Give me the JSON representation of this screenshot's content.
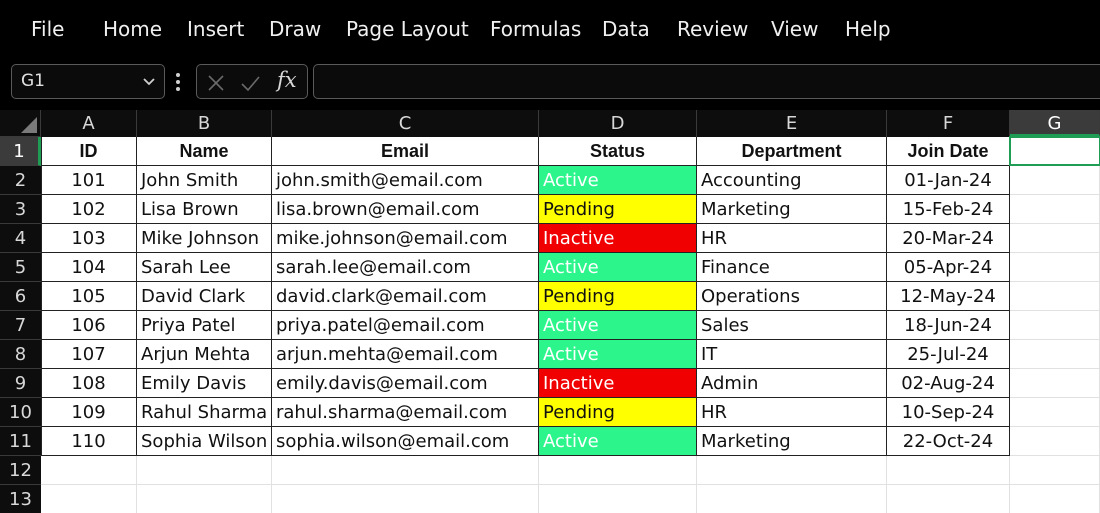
{
  "menu": [
    "File",
    "Home",
    "Insert",
    "Draw",
    "Page Layout",
    "Formulas",
    "Data",
    "Review",
    "View",
    "Help"
  ],
  "formula_bar": {
    "name_box": "G1",
    "fx_label": "fx",
    "formula": "",
    "icons": [
      "chevron-down-icon",
      "more-options-icon",
      "cancel-x-icon",
      "enter-check-icon"
    ]
  },
  "columns": [
    "A",
    "B",
    "C",
    "D",
    "E",
    "F",
    "G"
  ],
  "selected_column": "G",
  "selected_row": "1",
  "row_numbers": [
    "1",
    "2",
    "3",
    "4",
    "5",
    "6",
    "7",
    "8",
    "9",
    "10",
    "11",
    "12",
    "13"
  ],
  "table": {
    "headers": [
      "ID",
      "Name",
      "Email",
      "Status",
      "Department",
      "Join Date"
    ],
    "rows": [
      [
        "101",
        "John Smith",
        "john.smith@email.com",
        "Active",
        "Accounting",
        "01-Jan-24"
      ],
      [
        "102",
        "Lisa Brown",
        "lisa.brown@email.com",
        "Pending",
        "Marketing",
        "15-Feb-24"
      ],
      [
        "103",
        "Mike Johnson",
        "mike.johnson@email.com",
        "Inactive",
        "HR",
        "20-Mar-24"
      ],
      [
        "104",
        "Sarah Lee",
        "sarah.lee@email.com",
        "Active",
        "Finance",
        "05-Apr-24"
      ],
      [
        "105",
        "David Clark",
        "david.clark@email.com",
        "Pending",
        "Operations",
        "12-May-24"
      ],
      [
        "106",
        "Priya Patel",
        "priya.patel@email.com",
        "Active",
        "Sales",
        "18-Jun-24"
      ],
      [
        "107",
        "Arjun Mehta",
        "arjun.mehta@email.com",
        "Active",
        "IT",
        "25-Jul-24"
      ],
      [
        "108",
        "Emily Davis",
        "emily.davis@email.com",
        "Inactive",
        "Admin",
        "02-Aug-24"
      ],
      [
        "109",
        "Rahul Sharma",
        "rahul.sharma@email.com",
        "Pending",
        "HR",
        "10-Sep-24"
      ],
      [
        "110",
        "Sophia Wilson",
        "sophia.wilson@email.com",
        "Active",
        "Marketing",
        "22-Oct-24"
      ]
    ]
  },
  "colors": {
    "active": "#2cf58c",
    "pending": "#ffff00",
    "inactive": "#f00000",
    "selection": "#1f9d55"
  }
}
